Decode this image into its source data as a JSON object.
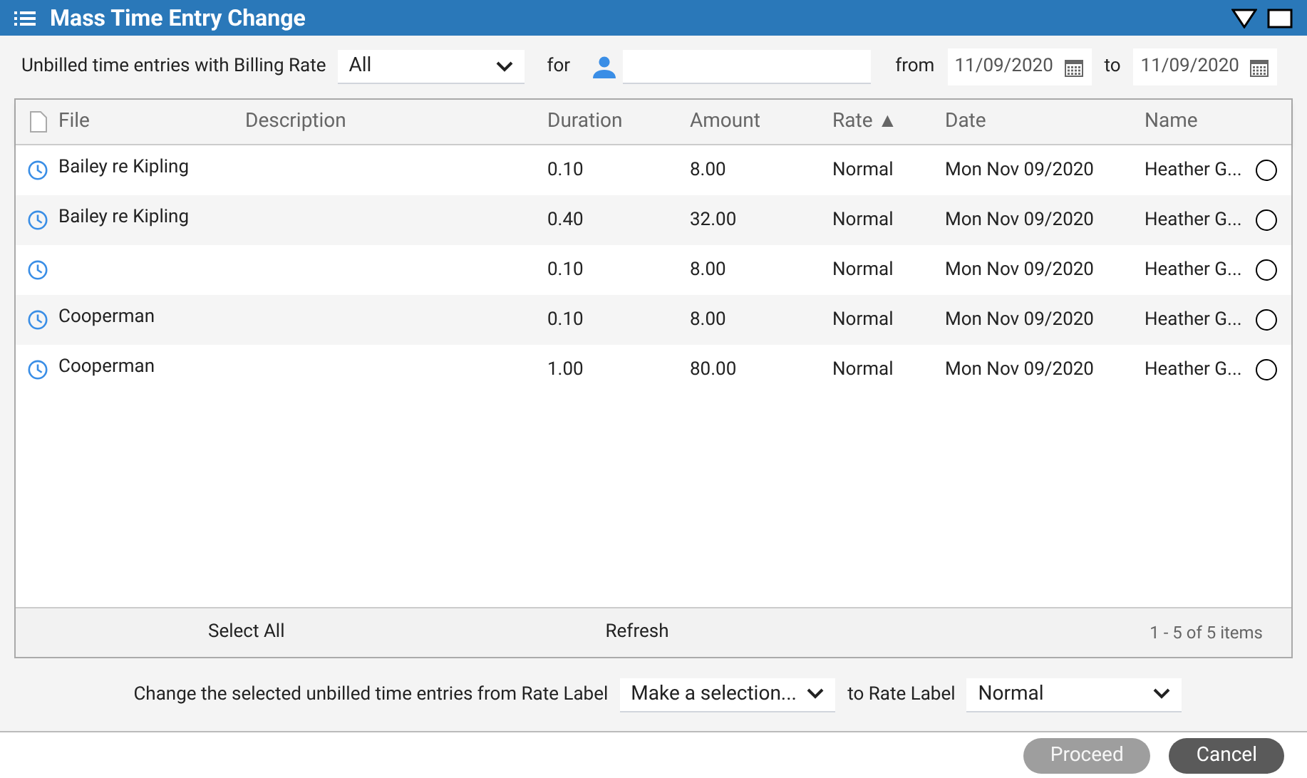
{
  "window": {
    "title": "Mass Time Entry Change"
  },
  "filter": {
    "label": "Unbilled time entries with Billing Rate",
    "billing_rate": "All",
    "for_label": "for",
    "from_label": "from",
    "from_date": "11/09/2020",
    "to_label": "to",
    "to_date": "11/09/2020"
  },
  "table": {
    "columns": [
      {
        "label": "File"
      },
      {
        "label": "Description"
      },
      {
        "label": "Duration"
      },
      {
        "label": "Amount"
      },
      {
        "label": "Rate",
        "sort_mark": "▲"
      },
      {
        "label": "Date"
      },
      {
        "label": "Name"
      }
    ],
    "rows": [
      {
        "file": "Bailey re Kipling",
        "duration": "0.10",
        "amount": "8.00",
        "rate": "Normal",
        "date": "Mon Nov 09/2020",
        "name": "Heather G...",
        "selected": false
      },
      {
        "file": "Bailey re Kipling",
        "duration": "0.40",
        "amount": "32.00",
        "rate": "Normal",
        "date": "Mon Nov 09/2020",
        "name": "Heather G...",
        "selected": false
      },
      {
        "duration": "0.10",
        "amount": "8.00",
        "rate": "Normal",
        "date": "Mon Nov 09/2020",
        "name": "Heather G...",
        "selected": false
      },
      {
        "file": "Cooperman",
        "duration": "0.10",
        "amount": "8.00",
        "rate": "Normal",
        "date": "Mon Nov 09/2020",
        "name": "Heather G...",
        "selected": false
      },
      {
        "file": "Cooperman",
        "duration": "1.00",
        "amount": "80.00",
        "rate": "Normal",
        "date": "Mon Nov 09/2020",
        "name": "Heather G...",
        "selected": false
      }
    ],
    "footer": {
      "select_all": "Select All",
      "refresh": "Refresh",
      "count": "1 - 5 of 5 items"
    }
  },
  "change": {
    "label": "Change the selected unbilled time entries from Rate Label",
    "from_value": "Make a selection...",
    "to_label": "to Rate Label",
    "to_value": "Normal"
  },
  "buttons": [
    {
      "label": "Proceed",
      "disabled": true
    },
    {
      "label": "Cancel",
      "disabled": false
    }
  ]
}
